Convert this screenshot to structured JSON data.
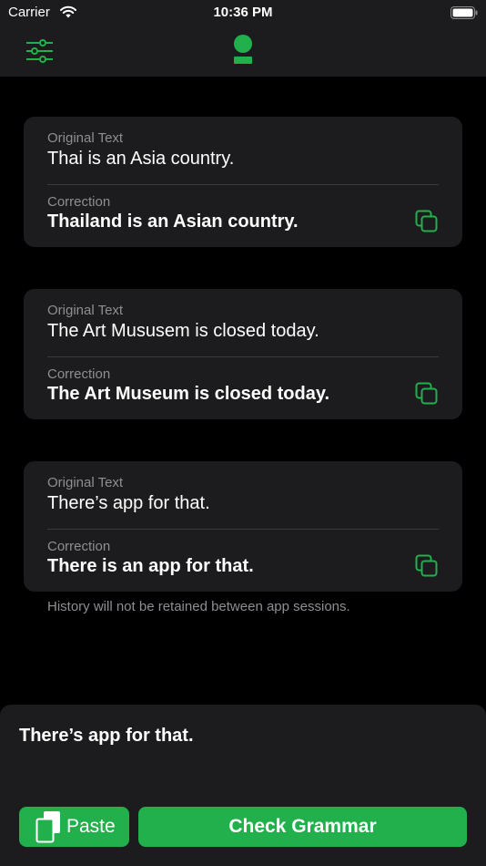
{
  "status_bar": {
    "carrier": "Carrier",
    "time": "10:36 PM"
  },
  "nav": {
    "filter_icon": "sliders-icon",
    "logo_icon": "person-logo-icon"
  },
  "colors": {
    "accent": "#21b04b",
    "background": "#000000",
    "card": "#1c1c1e",
    "secondary_text": "#8e8e93"
  },
  "history": [
    {
      "original_label": "Original Text",
      "original": "Thai is an Asia country.",
      "correction_label": "Correction",
      "correction": "Thailand is an Asian country."
    },
    {
      "original_label": "Original Text",
      "original": "The Art Mususem is closed today.",
      "correction_label": "Correction",
      "correction": "The Art Museum is closed today."
    },
    {
      "original_label": "Original Text",
      "original": "There’s app for that.",
      "correction_label": "Correction",
      "correction": "There is an app for that."
    }
  ],
  "footnote": "History will not be retained between app sessions.",
  "input": {
    "value": "There’s app for that."
  },
  "buttons": {
    "paste_label": "Paste",
    "check_label": "Check Grammar"
  }
}
